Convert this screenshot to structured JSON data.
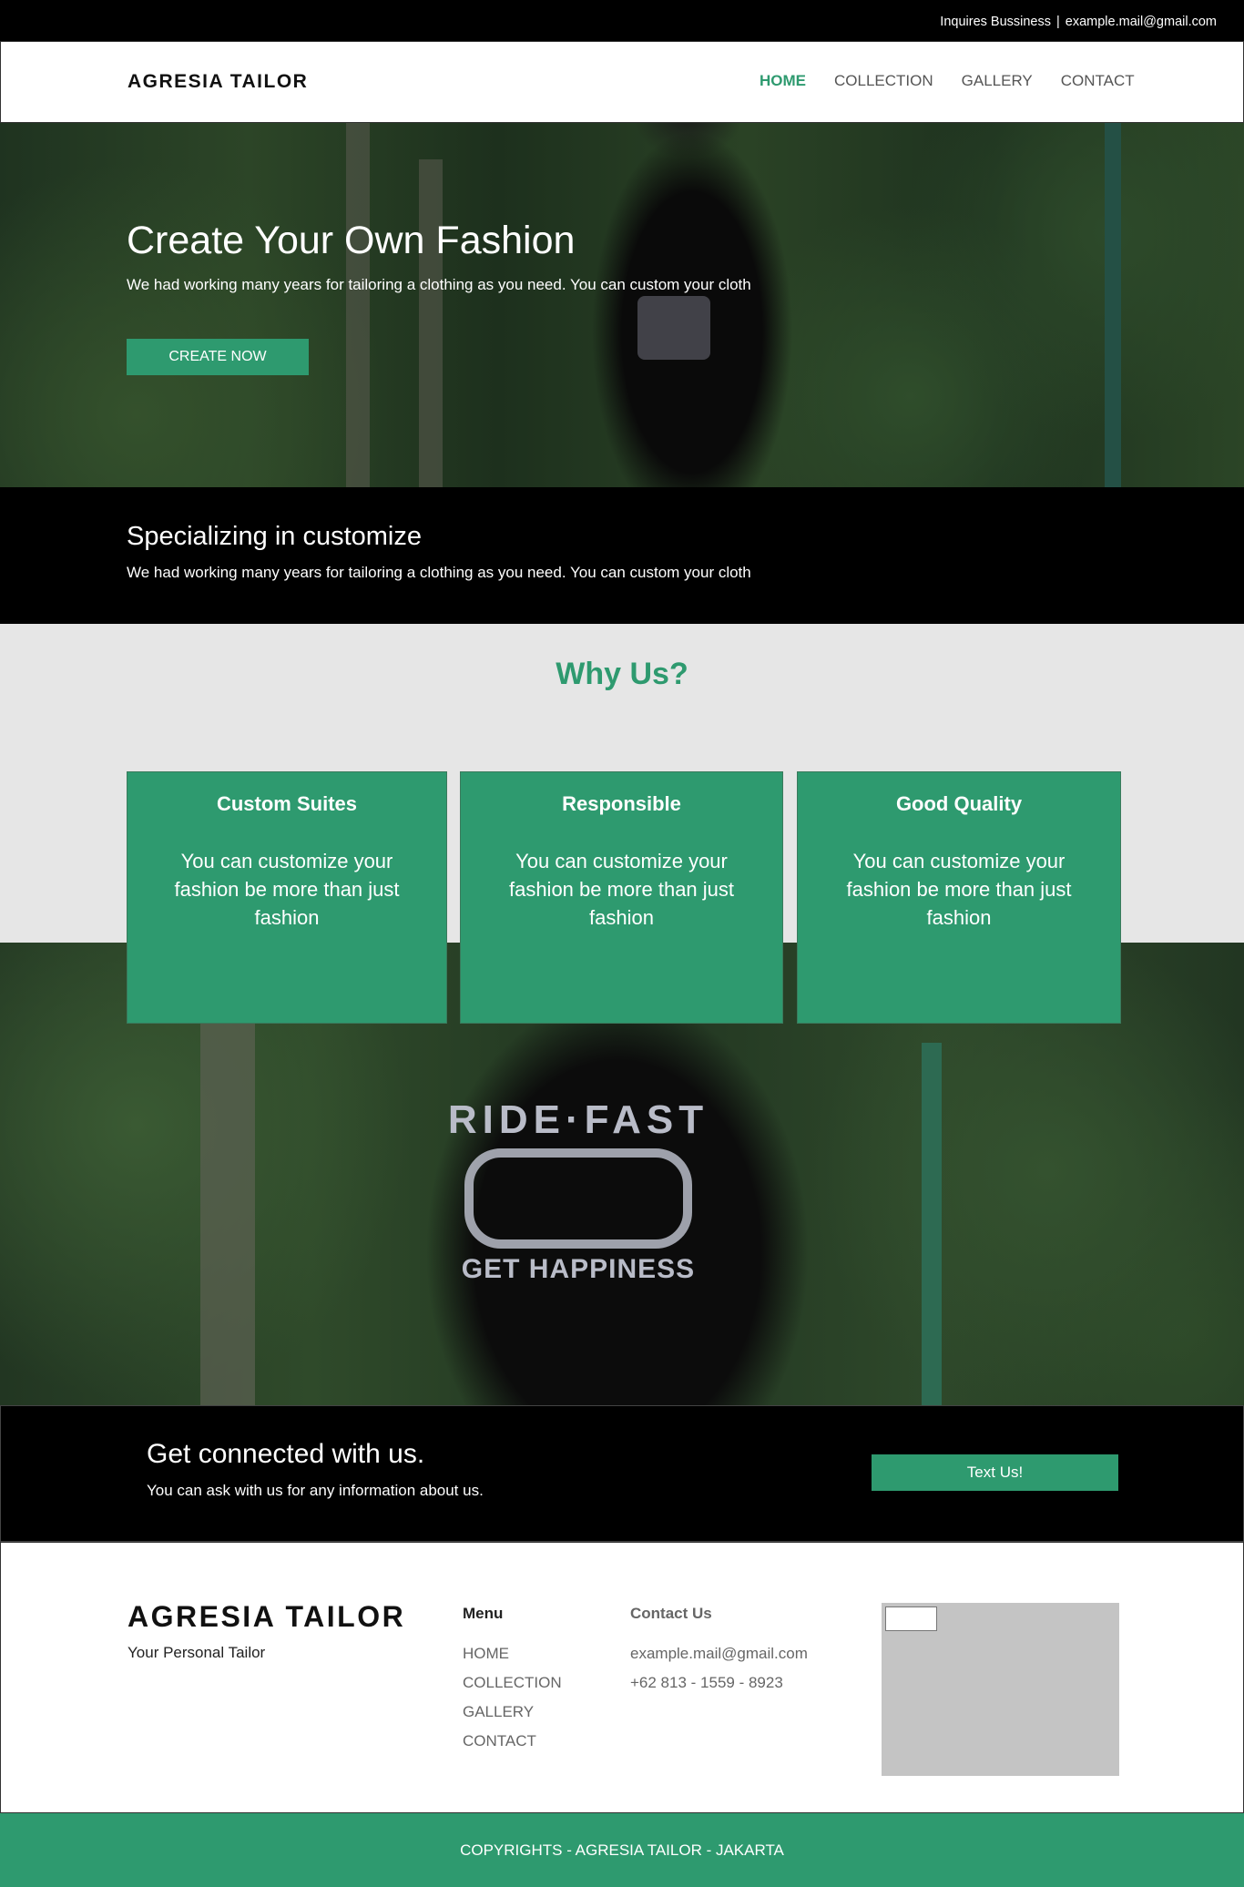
{
  "topbar": {
    "label": "Inquires Bussiness",
    "separator": "|",
    "email": "example.mail@gmail.com"
  },
  "navbar": {
    "brand": "AGRESIA TAILOR",
    "items": [
      {
        "label": "HOME",
        "active": true
      },
      {
        "label": "COLLECTION",
        "active": false
      },
      {
        "label": "GALLERY",
        "active": false
      },
      {
        "label": "CONTACT",
        "active": false
      }
    ]
  },
  "hero": {
    "title": "Create Your Own Fashion",
    "text": "We had working many years for tailoring a clothing as you need. You can custom your cloth",
    "button": "CREATE NOW"
  },
  "special": {
    "title": "Specializing in customize",
    "text": "We had working many years for tailoring a clothing as you need. You can custom your cloth"
  },
  "why": {
    "title": "Why Us?",
    "cards": [
      {
        "title": "Custom Suites",
        "text": "You can customize your fashion be more than just fashion"
      },
      {
        "title": "Responsible",
        "text": "You can customize your fashion be more than just fashion"
      },
      {
        "title": "Good Quality",
        "text": "You can customize your fashion be more than just fashion"
      }
    ]
  },
  "connect": {
    "title": "Get connected with us.",
    "text": "You can ask with us for any information about us.",
    "button": "Text Us!"
  },
  "footer": {
    "brand": "AGRESIA TAILOR",
    "tagline": "Your Personal Tailor",
    "menu_title": "Menu",
    "menu": [
      "HOME",
      "COLLECTION",
      "GALLERY",
      "CONTACT"
    ],
    "contact_title": "Contact Us",
    "contact": [
      "example.mail@gmail.com",
      "+62 813 - 1559 - 8923"
    ]
  },
  "copyright": "COPYRIGHTS - AGRESIA TAILOR - JAKARTA",
  "colors": {
    "accent": "#2e9a6f",
    "dark": "#000000",
    "light_gray": "#e6e6e6"
  }
}
